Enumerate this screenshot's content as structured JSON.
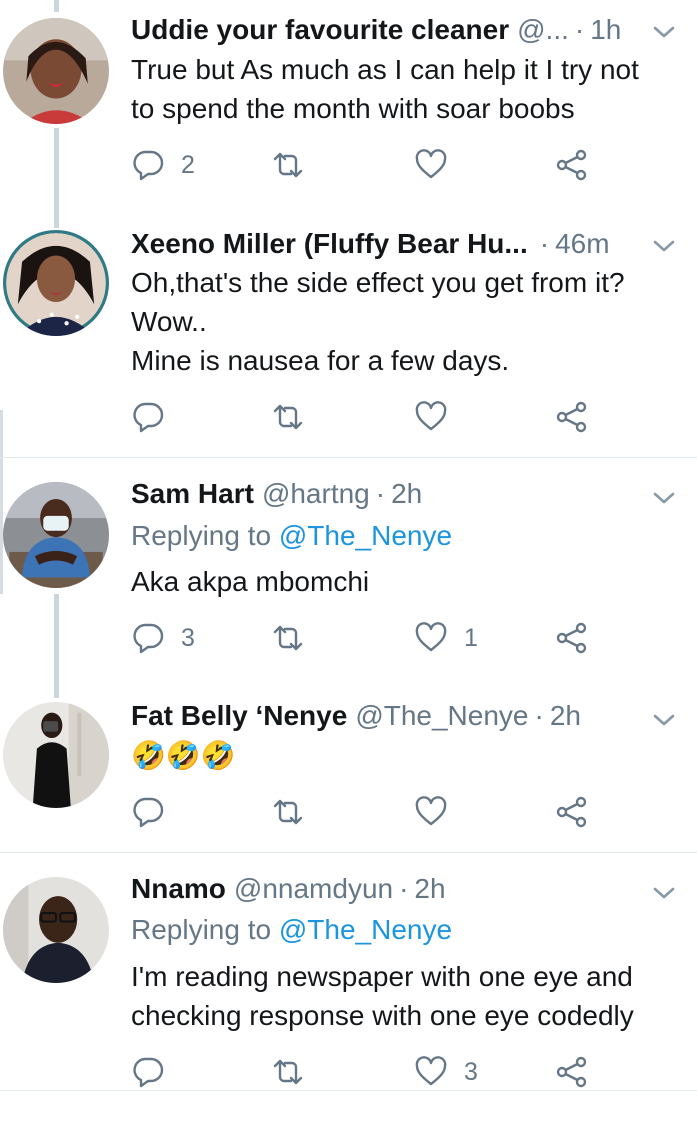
{
  "tweets": [
    {
      "name": "Uddie your favourite cleaner",
      "handle": "@...",
      "time": "1h",
      "replying_label": "",
      "replying_mention": "",
      "text_lines": [
        "True but As much as I can help it I try not",
        "to spend the month with soar boobs"
      ],
      "emoji": "",
      "reply_count": "2",
      "retweet_count": "",
      "like_count": ""
    },
    {
      "name": "Xeeno Miller (Fluffy Bear Hu...",
      "handle": "",
      "time": "46m",
      "replying_label": "",
      "replying_mention": "",
      "text_lines": [
        "Oh,that's the side effect you get from it?",
        "Wow..",
        "Mine is nausea for a few days."
      ],
      "emoji": "",
      "reply_count": "",
      "retweet_count": "",
      "like_count": ""
    },
    {
      "name": "Sam Hart",
      "handle": "@hartng",
      "time": "2h",
      "replying_label": "Replying to",
      "replying_mention": "@The_Nenye",
      "text_lines": [
        "Aka akpa mbomchi"
      ],
      "emoji": "",
      "reply_count": "3",
      "retweet_count": "",
      "like_count": "1"
    },
    {
      "name": "Fat Belly ‘Nenye",
      "handle": "@The_Nenye",
      "time": "2h",
      "replying_label": "",
      "replying_mention": "",
      "text_lines": [],
      "emoji": "🤣🤣🤣",
      "reply_count": "",
      "retweet_count": "",
      "like_count": ""
    },
    {
      "name": "Nnamo",
      "handle": "@nnamdyun",
      "time": "2h",
      "replying_label": "Replying to",
      "replying_mention": "@The_Nenye",
      "text_lines": [
        "I'm reading newspaper with one eye and",
        "checking response with one eye codedly"
      ],
      "emoji": "",
      "reply_count": "",
      "retweet_count": "",
      "like_count": "3"
    }
  ],
  "time_separator": "·",
  "icons": {
    "reply": "reply-icon",
    "retweet": "retweet-icon",
    "like": "heart-icon",
    "share": "share-icon",
    "menu": "chevron-down-icon"
  },
  "colors": {
    "text": "#14171a",
    "muted": "#657786",
    "mention": "#1b95e0",
    "thread_line": "#ccd6dd",
    "divider": "#e1e8ed"
  }
}
